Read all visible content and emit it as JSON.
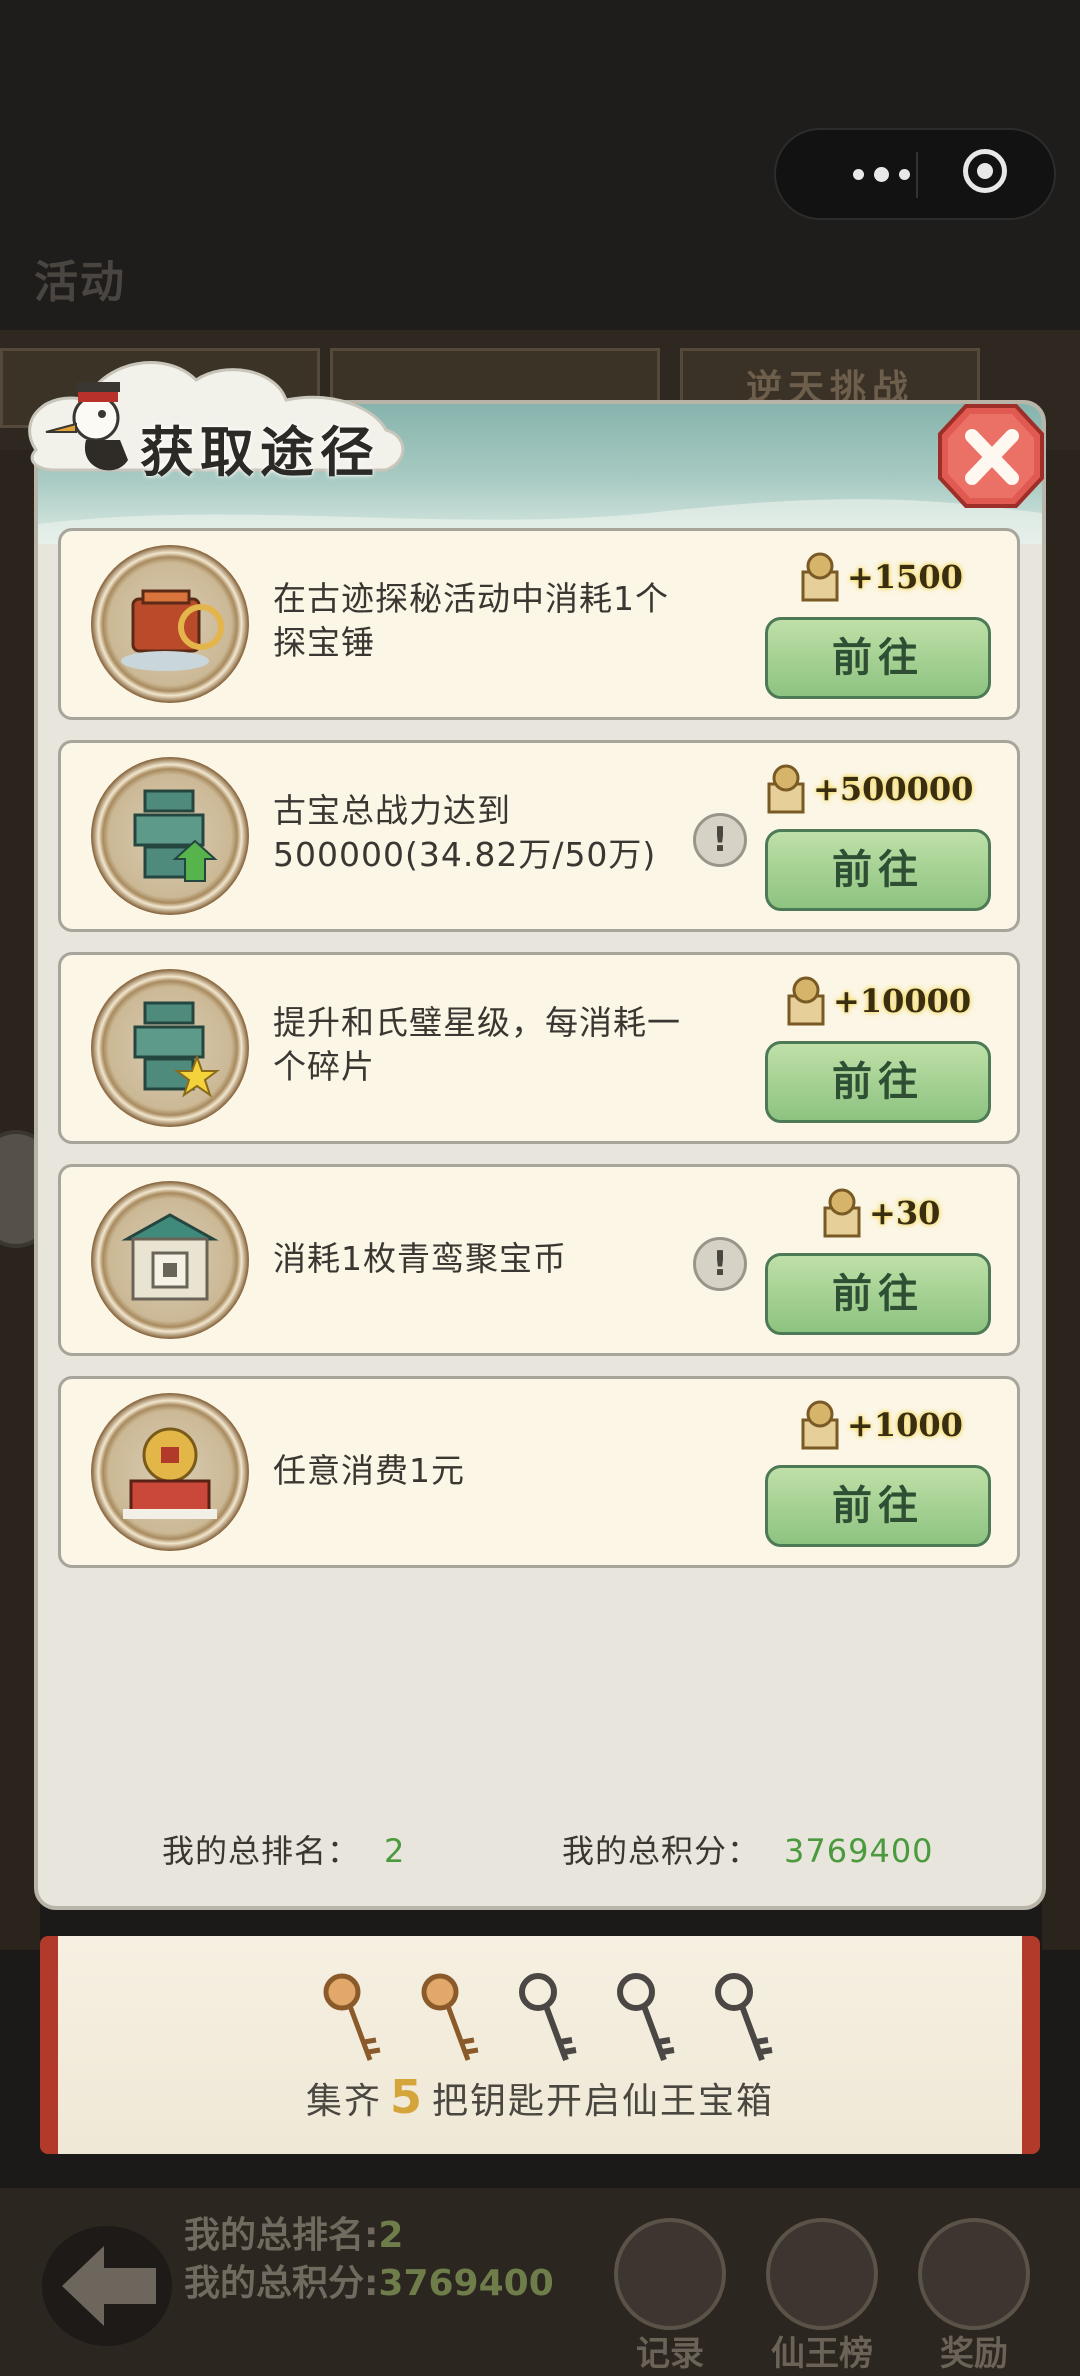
{
  "header": {
    "title": "活动"
  },
  "bg_tabs": {
    "challenge": "逆天挑战"
  },
  "modal": {
    "title": "获取途径",
    "items": [
      {
        "desc": "在古迹探秘活动中消耗1个探宝锤",
        "reward": "+1500",
        "button": "前往",
        "has_info": false
      },
      {
        "desc": "古宝总战力达到500000(34.82万/50万)",
        "reward": "+500000",
        "button": "前往",
        "has_info": true
      },
      {
        "desc": "提升和氏璧星级，每消耗一个碎片",
        "reward": "+10000",
        "button": "前往",
        "has_info": false
      },
      {
        "desc": "消耗1枚青鸾聚宝币",
        "reward": "+30",
        "button": "前往",
        "has_info": true
      },
      {
        "desc": "任意消费1元",
        "reward": "+1000",
        "button": "前往",
        "has_info": false
      }
    ],
    "rank_label": "我的总排名：",
    "rank_value": "2",
    "score_label": "我的总积分：",
    "score_value": "3769400"
  },
  "banner": {
    "prefix": "集齐",
    "count": "5",
    "suffix": "把钥匙开启仙王宝箱",
    "keys_owned": 2,
    "keys_total": 5
  },
  "footer": {
    "rank_text": "我的总排名:",
    "rank_value": "2",
    "score_text": "我的总积分:",
    "score_value": "3769400",
    "nav": [
      {
        "label": "记录"
      },
      {
        "label": "仙王榜"
      },
      {
        "label": "奖励"
      }
    ]
  },
  "colors": {
    "accent_green": "#4b9a3e",
    "button_green": "#8dc380",
    "close_red": "#e05a52"
  }
}
